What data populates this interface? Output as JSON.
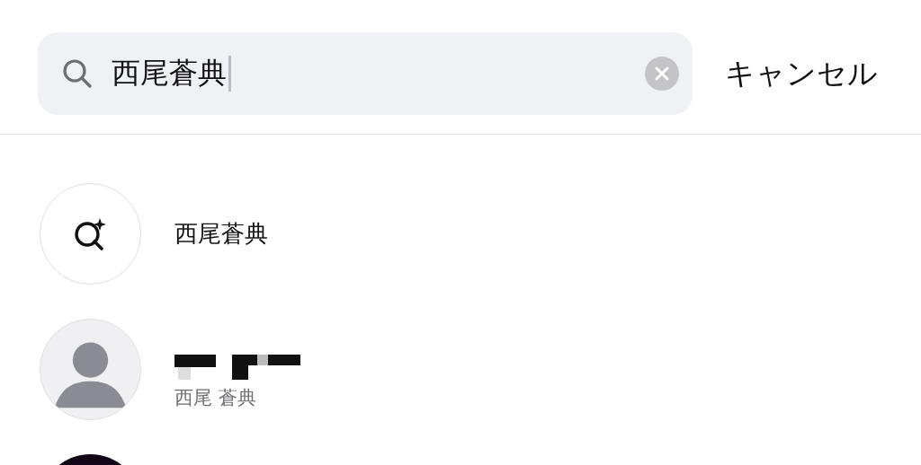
{
  "search": {
    "value": "西尾蒼典",
    "focused": true,
    "cancel_label": "キャンセル"
  },
  "results": [
    {
      "kind": "suggestion",
      "title": "西尾蒼典"
    },
    {
      "kind": "user",
      "subtitle": "西尾 蒼典"
    },
    {
      "kind": "user_cut"
    }
  ]
}
